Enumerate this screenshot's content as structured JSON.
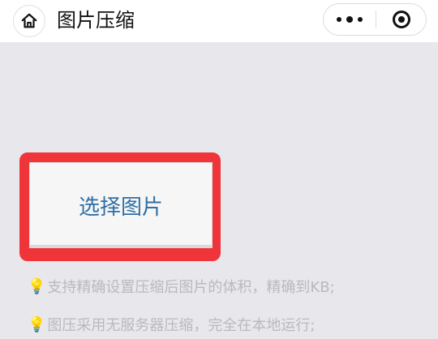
{
  "navbar": {
    "title": "图片压缩",
    "home_icon": "home-icon",
    "more_icon": "more-icon",
    "close_icon": "target-icon"
  },
  "main": {
    "select_button_label": "选择图片",
    "highlight_color": "#f0353a",
    "button_text_color": "#2f6fa6"
  },
  "tips": [
    {
      "icon": "lightbulb-icon",
      "text": "支持精确设置压缩后图片的体积，精确到KB;"
    },
    {
      "icon": "lightbulb-icon",
      "text": "图压采用无服务器压缩，完全在本地运行;"
    }
  ]
}
